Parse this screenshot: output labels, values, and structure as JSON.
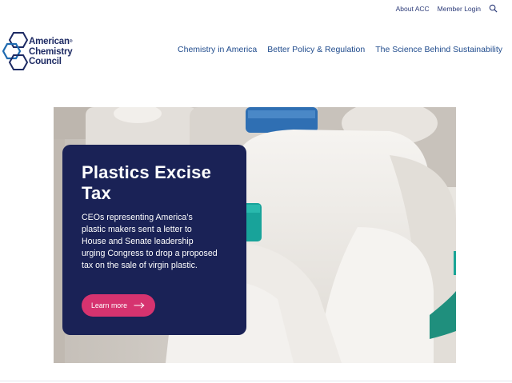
{
  "utility_nav": {
    "links": [
      "About ACC",
      "Member Login"
    ],
    "search_icon": "search-icon"
  },
  "logo": {
    "line1": "American",
    "line2": "Chemistry",
    "line3": "Council",
    "mark": "®",
    "brand_color": "#1d2a63",
    "accent_color": "#1e6ab0"
  },
  "main_nav": {
    "items": [
      "Chemistry in America",
      "Better Policy & Regulation",
      "The Science Behind Sustainability"
    ]
  },
  "hero": {
    "title": "Plastics Excise Tax",
    "body": "CEOs representing America’s plastic makers sent a letter to House and Senate leadership urging Congress to drop a proposed tax on the sale of virgin plastic.",
    "cta_label": "Learn more",
    "cta_icon": "arrow-right-icon",
    "card_color": "#1a2256",
    "cta_color": "#d6336f"
  }
}
